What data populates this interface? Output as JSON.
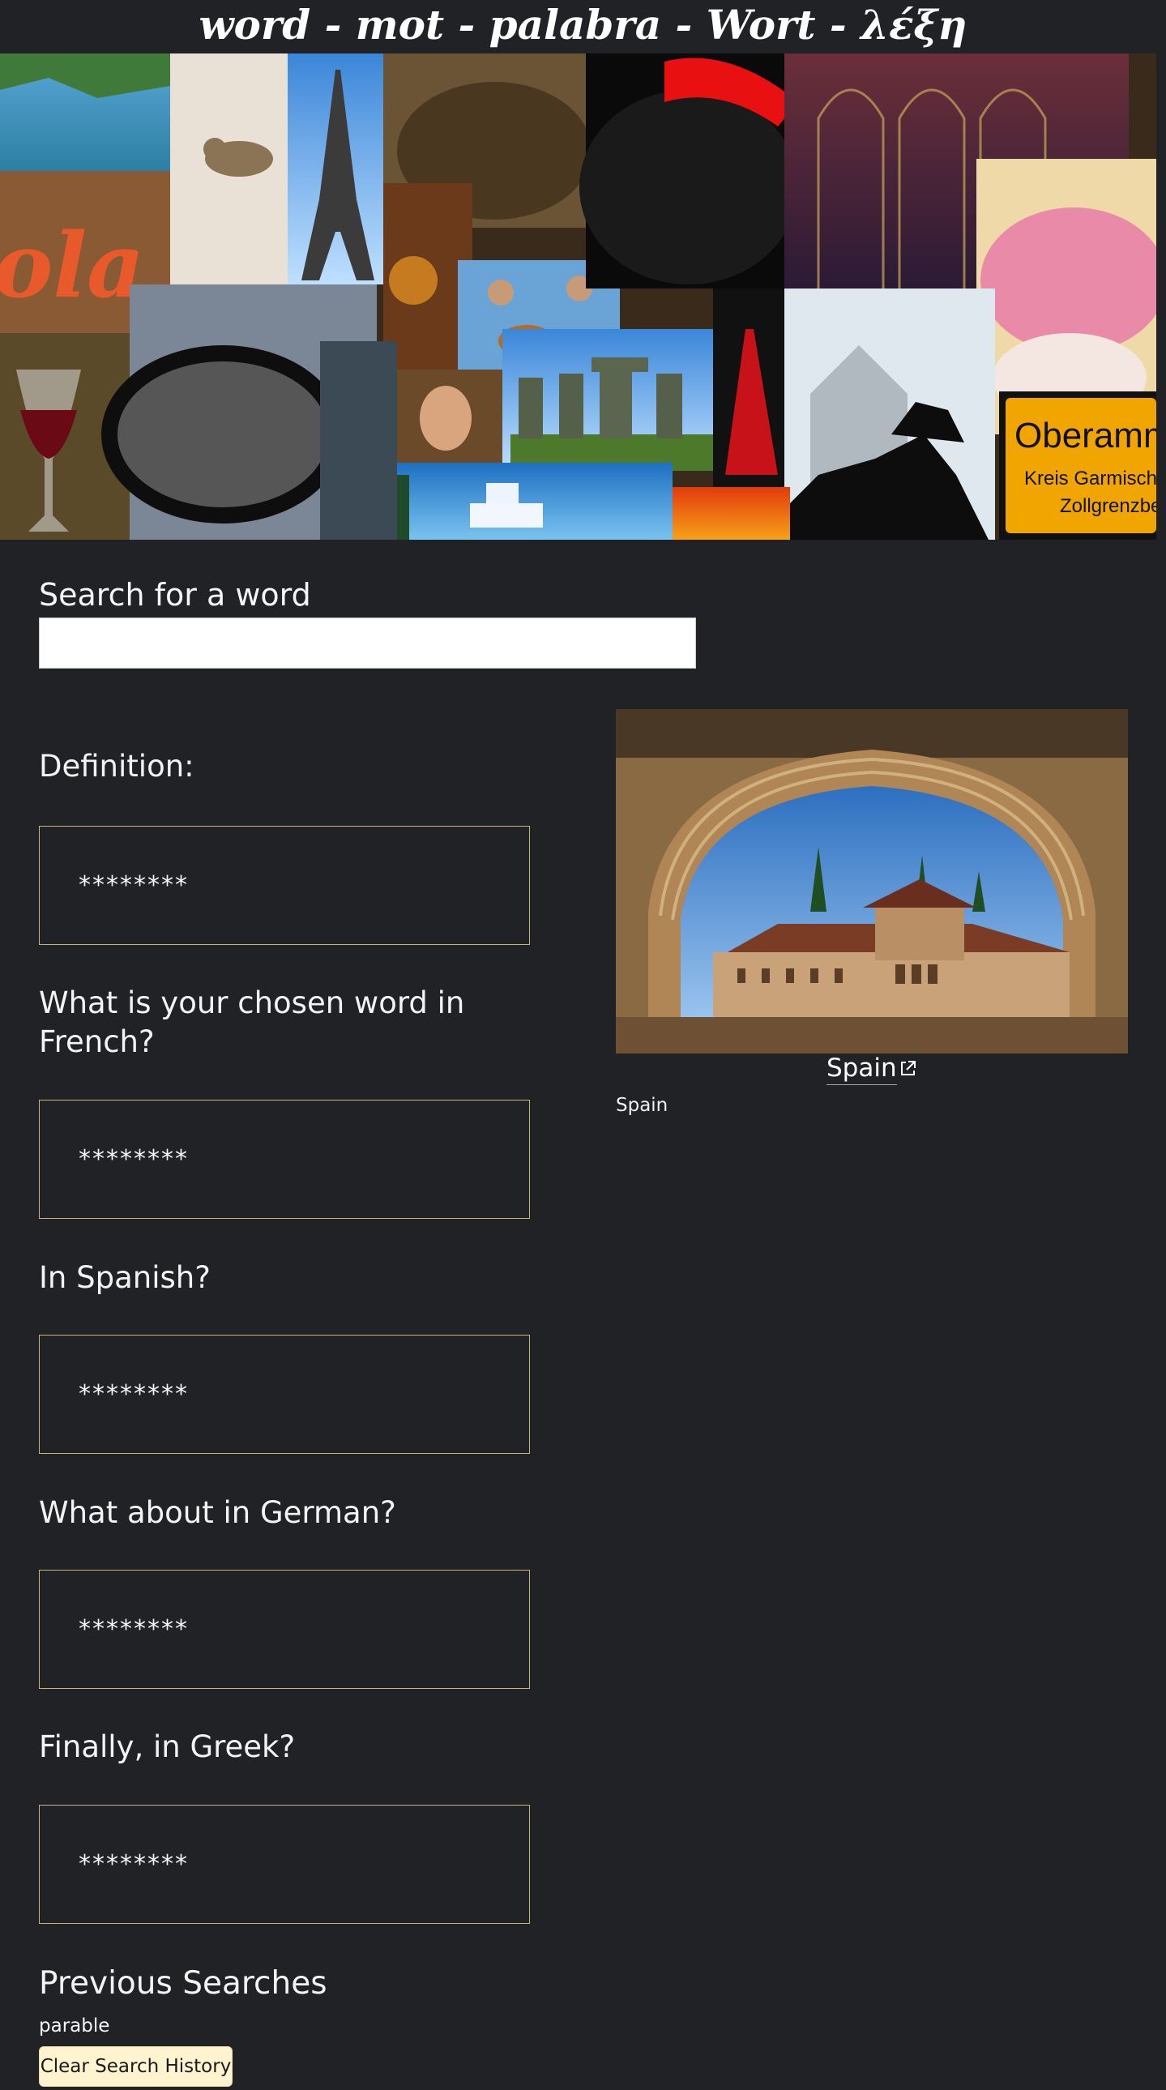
{
  "header": {
    "title": "word - mot - palabra - Wort - λέξη"
  },
  "banner": {
    "sign_line1": "Oberamme",
    "sign_line2": "Kreis Garmisch-P",
    "sign_line3": "Zollgrenzbez",
    "neon_text": "ola"
  },
  "search": {
    "label": "Search for a word",
    "value": "",
    "placeholder": ""
  },
  "questions": [
    {
      "label": "Definition:",
      "answer": "********"
    },
    {
      "label": "What is your chosen word in French?",
      "answer": "********"
    },
    {
      "label": "In Spanish?",
      "answer": "********"
    },
    {
      "label": "What about in German?",
      "answer": "********"
    },
    {
      "label": "Finally, in Greek?",
      "answer": "********"
    }
  ],
  "photo": {
    "link_text": "Spain",
    "caption": "Spain",
    "icon": "external-link-icon"
  },
  "history": {
    "title": "Previous Searches",
    "items": [
      "parable"
    ],
    "clear_label": "Clear Search History"
  },
  "colors": {
    "background": "#202226",
    "answer_border": "#c9b37a",
    "button_bg": "#fff4cf",
    "sign_yellow": "#f0a500"
  }
}
